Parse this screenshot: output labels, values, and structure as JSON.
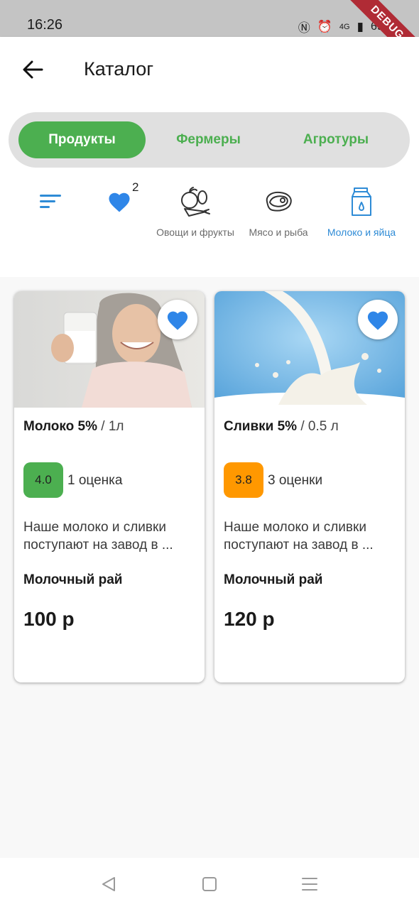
{
  "status_bar": {
    "time": "16:26",
    "network": "4G",
    "battery": "69%",
    "debug_label": "DEBUG",
    "icons": [
      "nfc-icon",
      "alarm-icon",
      "signal-icon",
      "battery-icon"
    ]
  },
  "header": {
    "title": "Каталог",
    "back_icon": "arrow-left-icon"
  },
  "tabs": [
    {
      "label": "Продукты",
      "active": true
    },
    {
      "label": "Фермеры",
      "active": false
    },
    {
      "label": "Агротуры",
      "active": false
    }
  ],
  "favorites_count": "2",
  "categories": [
    {
      "label": "Овощи и фрукты",
      "icon": "vegetables-icon",
      "active": false
    },
    {
      "label": "Мясо и рыба",
      "icon": "meat-icon",
      "active": false
    },
    {
      "label": "Молоко и яйца",
      "icon": "milk-icon",
      "active": true
    }
  ],
  "products": [
    {
      "name": "Молоко 5%",
      "volume": " / 1л",
      "rating": "4.0",
      "rating_color": "#4caf50",
      "reviews": "1 оценка",
      "description": "Наше молоко и сливки поступают на завод в ...",
      "brand": "Молочный рай",
      "price": "100 р"
    },
    {
      "name": "Сливки 5%",
      "volume": " / 0.5 л",
      "rating": "3.8",
      "rating_color": "#ff9800",
      "reviews": "3 оценки",
      "description": "Наше молоко и сливки поступают на завод в ...",
      "brand": "Молочный рай",
      "price": "120 р"
    }
  ],
  "colors": {
    "accent_green": "#4caf50",
    "accent_blue": "#2e8bd6",
    "heart_blue": "#2f86e8"
  }
}
